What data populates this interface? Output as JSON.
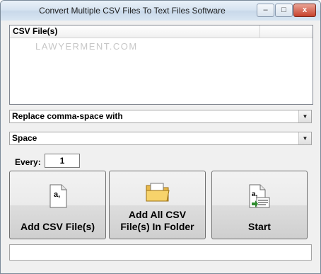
{
  "window": {
    "title": "Convert Multiple CSV Files To Text Files Software",
    "minimize_glyph": "–",
    "maximize_glyph": "□",
    "close_glyph": "x"
  },
  "list": {
    "column_header": "CSV File(s)",
    "watermark": "LAWYERMENT.COM"
  },
  "replace_select": {
    "value": "Replace comma-space with"
  },
  "with_select": {
    "value": "Space"
  },
  "every": {
    "label": "Every:",
    "value": "1"
  },
  "buttons": {
    "add_csv": {
      "line1": "Add CSV File(s)",
      "line2": "",
      "icon": "document-icon"
    },
    "add_folder": {
      "line1": "Add All CSV",
      "line2": "File(s) In Folder",
      "icon": "folder-icon"
    },
    "start": {
      "line1": "Start",
      "line2": "",
      "icon": "convert-icon"
    }
  },
  "status": {
    "text": ""
  }
}
